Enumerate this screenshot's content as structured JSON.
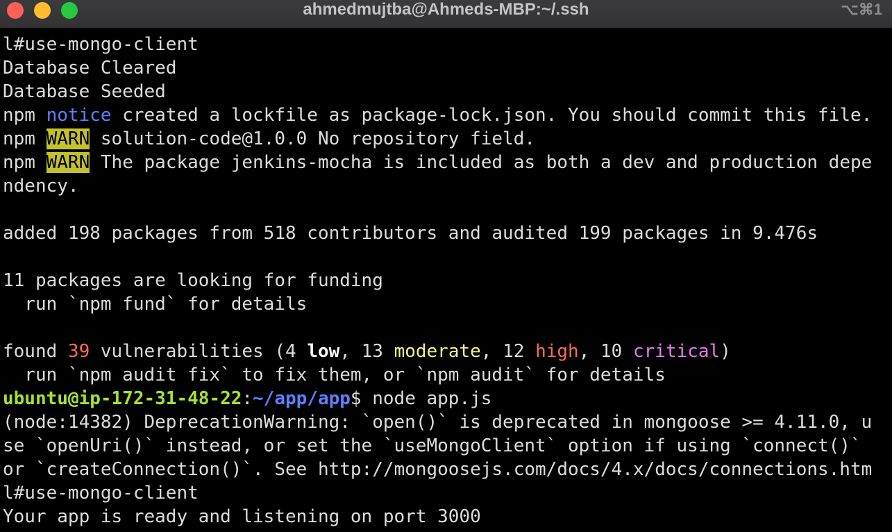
{
  "window": {
    "title": "ahmedmujtba@Ahmeds-MBP:~/.ssh",
    "shortcut": "⌥⌘1"
  },
  "terminal": {
    "l0": "l#use-mongo-client",
    "l1": "Database Cleared",
    "l2": "Database Seeded",
    "l3": {
      "a": "npm ",
      "b": "notice",
      "c": " created a lockfile as package-lock.json. You should commit this file."
    },
    "l4": {
      "a": "npm ",
      "b": "WARN",
      "c": " solution-code@1.0.0 No repository field."
    },
    "l5": {
      "a": "npm ",
      "b": "WARN",
      "c": " The package jenkins-mocha is included as both a dev and production depe"
    },
    "l6": "ndency.",
    "l8": "added 198 packages from 518 contributors and audited 199 packages in 9.476s",
    "l10": "11 packages are looking for funding",
    "l11": "  run `npm fund` for details",
    "l13": {
      "a": "found ",
      "b": "39",
      "c": " vulnerabilities (4 ",
      "d": "low",
      "e": ", 13 ",
      "f": "moderate",
      "g": ", 12 ",
      "h": "high",
      "i": ", 10 ",
      "j": "critical",
      "k": ")"
    },
    "l14": "  run `npm audit fix` to fix them, or `npm audit` for details",
    "l15": {
      "user": "ubuntu@ip-172-31-48-22",
      "sep": ":",
      "path": "~/app/app",
      "cmd": "$ node app.js"
    },
    "l16": "(node:14382) DeprecationWarning: `open()` is deprecated in mongoose >= 4.11.0, u",
    "l17": "se `openUri()` instead, or set the `useMongoClient` option if using `connect()`",
    "l18": "or `createConnection()`. See http://mongoosejs.com/docs/4.x/docs/connections.htm",
    "l19": "l#use-mongo-client",
    "l20": "Your app is ready and listening on port 3000"
  },
  "colors": {
    "background": "#000000",
    "text": "#dcdcdc",
    "notice": "#5d80ff",
    "warn_bg": "#c3c12d",
    "vuln_count": "#ff6b57",
    "moderate": "#f6f683",
    "high": "#ff6b57",
    "critical": "#ec77f5",
    "prompt_user": "#a6e22e",
    "prompt_path": "#5d80ff"
  }
}
